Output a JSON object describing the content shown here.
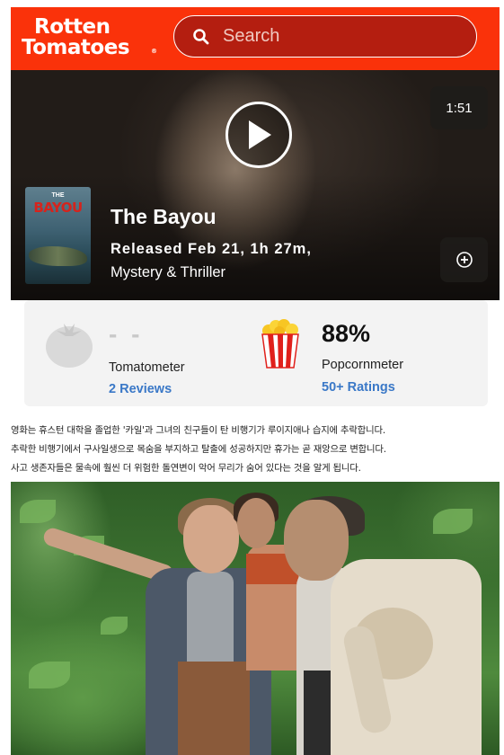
{
  "header": {
    "logo_line1": "Rotten",
    "logo_line2": "Tomatoes",
    "logo_reg": "®",
    "search_placeholder": "Search",
    "brand_color": "#fa320a"
  },
  "hero": {
    "duration": "1:51",
    "poster_the": "THE",
    "poster_title": "BAYOU",
    "title": "The Bayou",
    "released": "Released Feb 21, 1h 27m,",
    "genre": "Mystery & Thriller"
  },
  "scores": {
    "tomatometer_value": "- -",
    "tomatometer_label": "Tomatometer",
    "tomatometer_link": "2 Reviews",
    "popcornmeter_value": "88%",
    "popcornmeter_label": "Popcornmeter",
    "popcornmeter_link": "50+ Ratings",
    "link_color": "#3a78c7"
  },
  "synopsis": {
    "lines": [
      "영화는 휴스턴 대학을 졸업한 '카일'과 그녀의 친구들이 탄 비행기가 루이지애나 습지에 추락합니다.",
      "추락한 비행기에서 구사일생으로 목숨을 부지하고 탈출에 성공하지만 휴가는 곧 재앙으로 변합니다.",
      "사고 생존자들은 물속에 훨씬 더 위험한 돌연변이 악어 무리가 숨어 있다는 것을 알게 됩니다."
    ]
  },
  "icons": {
    "search": "search-icon",
    "play": "play-icon",
    "add": "add-circle-icon",
    "tomato": "tomato-icon",
    "popcorn": "popcorn-icon"
  }
}
